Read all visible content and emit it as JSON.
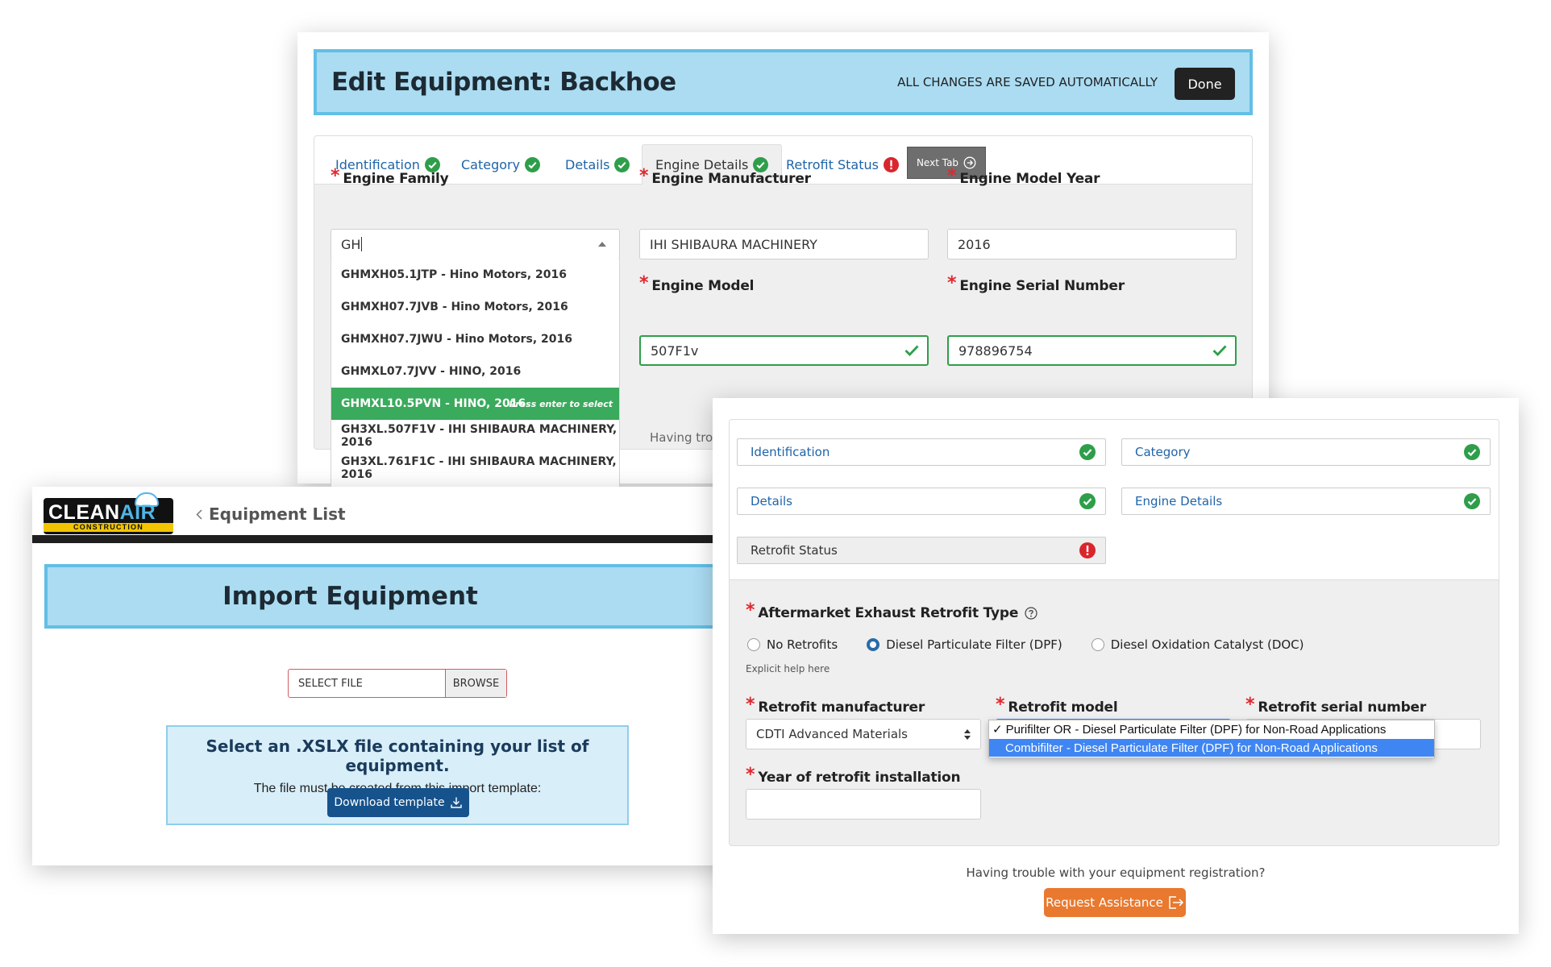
{
  "edit": {
    "title": "Edit Equipment: Backhoe",
    "saved_note": "ALL CHANGES ARE SAVED AUTOMATICALLY",
    "done_label": "Done",
    "tabs": [
      {
        "label": "Identification",
        "status": "complete"
      },
      {
        "label": "Category",
        "status": "complete"
      },
      {
        "label": "Details",
        "status": "complete"
      },
      {
        "label": "Engine Details",
        "status": "complete"
      },
      {
        "label": "Retrofit Status",
        "status": "error"
      }
    ],
    "next_tab_label": "Next Tab",
    "fields": {
      "engine_family": {
        "label": "Engine Family",
        "value": "GH"
      },
      "engine_manufacturer": {
        "label": "Engine Manufacturer",
        "value": "IHI SHIBAURA MACHINERY"
      },
      "engine_model_year": {
        "label": "Engine Model Year",
        "value": "2016"
      },
      "engine_model": {
        "label": "Engine Model",
        "value": "507F1v"
      },
      "engine_serial_number": {
        "label": "Engine Serial Number",
        "value": "978896754"
      }
    },
    "dropdown": [
      "GHMXH05.1JTP - Hino Motors, 2016",
      "GHMXH07.7JVB - Hino Motors, 2016",
      "GHMXH07.7JWU - Hino Motors, 2016",
      "GHMXL07.7JVV - HINO, 2016",
      "GHMXL10.5PVN - HINO, 2016",
      "GH3XL.507F1V - IHI SHIBAURA MACHINERY, 2016",
      "GH3XL.761F1C - IHI SHIBAURA MACHINERY, 2016"
    ],
    "dropdown_hint": "Press enter to select",
    "trouble_partial": "Having trou"
  },
  "import": {
    "logo": {
      "clean": "CLEAN",
      "air": "AIR",
      "sub": "CONSTRUCTION"
    },
    "breadcrumb": "Equipment List",
    "title": "Import Equipment",
    "file_placeholder": "SELECT FILE",
    "browse_label": "BROWSE",
    "info_heading": "Select an .XSLX file containing your list of equipment.",
    "info_text": "The file must be created from this import template:",
    "download_label": "Download template"
  },
  "retrofit": {
    "tabs": [
      {
        "label": "Identification",
        "status": "complete"
      },
      {
        "label": "Category",
        "status": "complete"
      },
      {
        "label": "Details",
        "status": "complete"
      },
      {
        "label": "Engine Details",
        "status": "complete"
      },
      {
        "label": "Retrofit Status",
        "status": "error"
      }
    ],
    "type_label": "Aftermarket Exhaust Retrofit Type",
    "type_options": [
      "No Retrofits",
      "Diesel Particulate Filter (DPF)",
      "Diesel Oxidation Catalyst (DOC)"
    ],
    "type_selected": "Diesel Particulate Filter (DPF)",
    "help_text": "Explicit help here",
    "manufacturer_label": "Retrofit manufacturer",
    "manufacturer_value": "CDTI Advanced Materials",
    "model_label": "Retrofit model",
    "model_options": [
      "Purifilter OR - Diesel Particulate Filter (DPF) for Non-Road Applications",
      "Combifilter - Diesel Particulate Filter (DPF) for Non-Road Applications"
    ],
    "serial_label": "Retrofit serial number",
    "year_label": "Year of retrofit installation",
    "year_value": "",
    "trouble_text": "Having trouble with your equipment registration?",
    "assist_label": "Request Assistance"
  },
  "colors": {
    "header_bg": "#abdcf2",
    "header_border": "#62bfe6",
    "success": "#2e9e4a",
    "error": "#d9252d",
    "highlight": "#3aaa5c",
    "primary": "#16528c",
    "assist": "#e8792f",
    "select_highlight": "#3f86f3"
  },
  "icons": [
    "check-circle-icon",
    "alert-circle-icon",
    "arrow-circle-right-icon",
    "caret-up-icon",
    "check-icon",
    "chevron-left-icon",
    "download-icon",
    "question-circle-icon",
    "updown-caret-icon",
    "exit-icon",
    "cloud-icon"
  ]
}
